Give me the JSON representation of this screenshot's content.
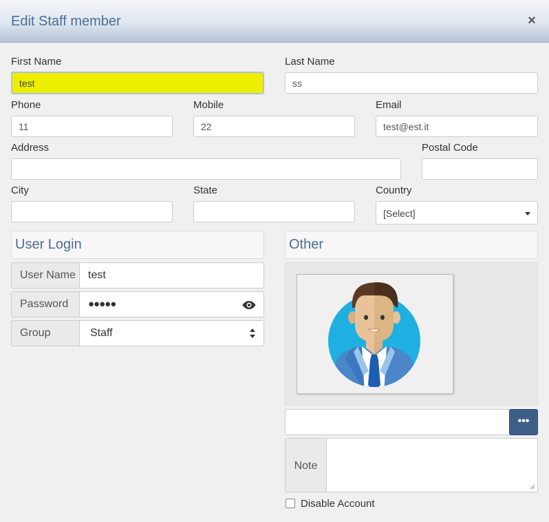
{
  "dialog": {
    "title": "Edit Staff member",
    "close_glyph": "×"
  },
  "form": {
    "first_name": {
      "label": "First Name",
      "value": "test"
    },
    "last_name": {
      "label": "Last Name",
      "value": "ss"
    },
    "phone": {
      "label": "Phone",
      "value": "11"
    },
    "mobile": {
      "label": "Mobile",
      "value": "22"
    },
    "email": {
      "label": "Email",
      "value": "test@est.it"
    },
    "address": {
      "label": "Address",
      "value": ""
    },
    "postal_code": {
      "label": "Postal Code",
      "value": ""
    },
    "city": {
      "label": "City",
      "value": ""
    },
    "state": {
      "label": "State",
      "value": ""
    },
    "country": {
      "label": "Country",
      "selected": "[Select]"
    }
  },
  "user_login": {
    "section_title": "User Login",
    "username": {
      "label": "User Name",
      "value": "test"
    },
    "password": {
      "label": "Password",
      "masked": "●●●●●"
    },
    "group": {
      "label": "Group",
      "selected": "Staff"
    }
  },
  "other": {
    "section_title": "Other",
    "photo_path": "",
    "browse_label": "•••",
    "note": {
      "label": "Note",
      "value": ""
    },
    "disable_account": {
      "label": "Disable Account",
      "checked": false
    }
  },
  "icons": {
    "close": "close-icon",
    "eye": "eye-icon",
    "dropdown": "chevron-down-icon",
    "updown": "updown-arrows-icon",
    "browse": "ellipsis-icon",
    "avatar": "person-avatar-icon"
  },
  "colors": {
    "accent": "#4a6d94",
    "focus_fill": "#eeee00",
    "browse_button": "#3d5f87",
    "avatar_bg": "#1fb0e2"
  }
}
